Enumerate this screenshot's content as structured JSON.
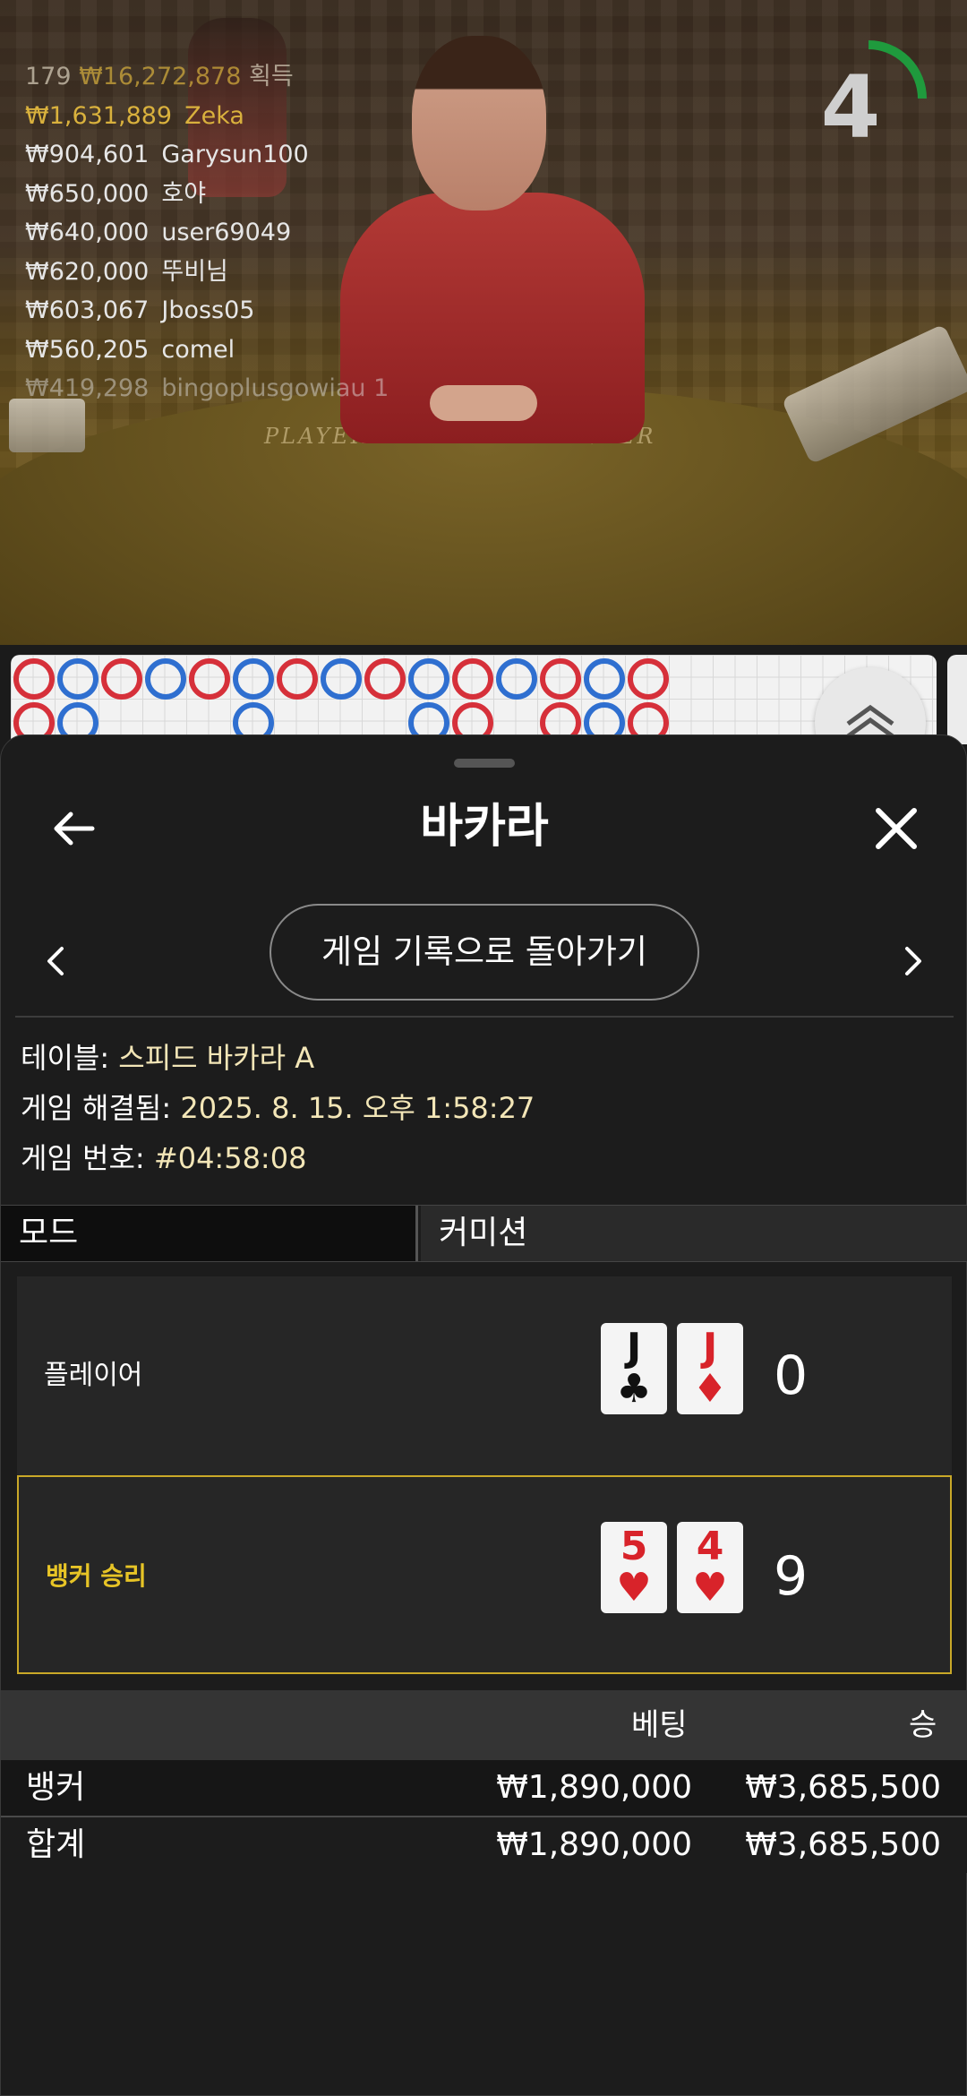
{
  "stream": {
    "header_line": "179 ",
    "header_won_amount": "₩16,272,878",
    "header_won_label": "획득",
    "winners": [
      {
        "amount": "₩1,631,889",
        "name": "Zeka",
        "highlight": true
      },
      {
        "amount": "₩904,601",
        "name": "Garysun100"
      },
      {
        "amount": "₩650,000",
        "name": "호야"
      },
      {
        "amount": "₩640,000",
        "name": "user69049"
      },
      {
        "amount": "₩620,000",
        "name": "뚜비님"
      },
      {
        "amount": "₩603,067",
        "name": "Jboss05"
      },
      {
        "amount": "₩560,205",
        "name": "comel"
      },
      {
        "amount": "₩419,298",
        "name": "bingoplusgowiau 1",
        "faded": true
      }
    ],
    "countdown": "4",
    "countdown_fraction": 0.25,
    "table_labels": {
      "player": "PLAYER",
      "banker": "BANKER"
    }
  },
  "road": {
    "row1": [
      "B",
      "P",
      "B",
      "P",
      "B",
      "P",
      "B",
      "P",
      "B",
      "P",
      "B",
      "P",
      "B",
      "P",
      "B"
    ],
    "row2": [
      "B",
      "P",
      "",
      "",
      "",
      "P",
      "",
      "",
      "",
      "P",
      "B",
      "",
      "B",
      "P",
      "B"
    ],
    "colors": {
      "player": "#2f6fd0",
      "banker": "#d6303a"
    }
  },
  "sheet": {
    "title": "바카라",
    "back_to_history": "게임 기록으로 돌아가기",
    "info": {
      "table_label": "테이블:",
      "table_value": "스피드 바카라 A",
      "resolved_label": "게임 해결됨:",
      "resolved_value": "2025. 8. 15. 오후 1:58:27",
      "number_label": "게임 번호:",
      "number_value": "#04:58:08"
    },
    "tabs": {
      "mode": "모드",
      "commission": "커미션"
    },
    "player": {
      "label": "플레이어",
      "cards": [
        {
          "rank": "J",
          "suit": "♣",
          "color": "black"
        },
        {
          "rank": "J",
          "suit": "♦",
          "color": "red"
        }
      ],
      "score": "0"
    },
    "banker": {
      "label": "뱅커 승리",
      "cards": [
        {
          "rank": "5",
          "suit": "♥",
          "color": "red"
        },
        {
          "rank": "4",
          "suit": "♥",
          "color": "red"
        }
      ],
      "score": "9"
    },
    "bets": {
      "headers": {
        "bet": "베팅",
        "win": "승"
      },
      "rows": [
        {
          "name": "뱅커",
          "bet": "₩1,890,000",
          "win": "₩3,685,500"
        }
      ],
      "total": {
        "name": "합계",
        "bet": "₩1,890,000",
        "win": "₩3,685,500"
      }
    }
  }
}
